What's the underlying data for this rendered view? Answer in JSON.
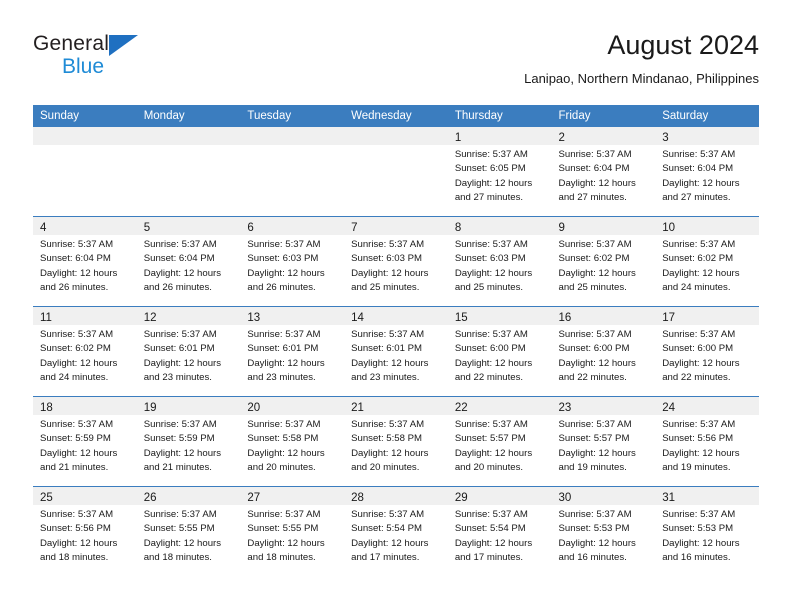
{
  "brand": {
    "name_top": "General",
    "name_bottom": "Blue",
    "accent_blue": "#1f8bd6",
    "triangle_blue": "#1f70c1"
  },
  "header": {
    "title": "August 2024",
    "subtitle": "Lanipao, Northern Mindanao, Philippines"
  },
  "theme": {
    "header_row_bg": "#3b7dbf",
    "header_row_text": "#ffffff",
    "daynum_band_bg": "#f0f0f0",
    "week_separator": "#3b7dbf",
    "cell_bg": "#ffffff",
    "text": "#1a1a1a"
  },
  "weekdays": [
    "Sunday",
    "Monday",
    "Tuesday",
    "Wednesday",
    "Thursday",
    "Friday",
    "Saturday"
  ],
  "weeks": [
    [
      {
        "day": "",
        "empty": true
      },
      {
        "day": "",
        "empty": true
      },
      {
        "day": "",
        "empty": true
      },
      {
        "day": "",
        "empty": true
      },
      {
        "day": "1",
        "sunrise": "Sunrise: 5:37 AM",
        "sunset": "Sunset: 6:05 PM",
        "daylight_1": "Daylight: 12 hours",
        "daylight_2": "and 27 minutes."
      },
      {
        "day": "2",
        "sunrise": "Sunrise: 5:37 AM",
        "sunset": "Sunset: 6:04 PM",
        "daylight_1": "Daylight: 12 hours",
        "daylight_2": "and 27 minutes."
      },
      {
        "day": "3",
        "sunrise": "Sunrise: 5:37 AM",
        "sunset": "Sunset: 6:04 PM",
        "daylight_1": "Daylight: 12 hours",
        "daylight_2": "and 27 minutes."
      }
    ],
    [
      {
        "day": "4",
        "sunrise": "Sunrise: 5:37 AM",
        "sunset": "Sunset: 6:04 PM",
        "daylight_1": "Daylight: 12 hours",
        "daylight_2": "and 26 minutes."
      },
      {
        "day": "5",
        "sunrise": "Sunrise: 5:37 AM",
        "sunset": "Sunset: 6:04 PM",
        "daylight_1": "Daylight: 12 hours",
        "daylight_2": "and 26 minutes."
      },
      {
        "day": "6",
        "sunrise": "Sunrise: 5:37 AM",
        "sunset": "Sunset: 6:03 PM",
        "daylight_1": "Daylight: 12 hours",
        "daylight_2": "and 26 minutes."
      },
      {
        "day": "7",
        "sunrise": "Sunrise: 5:37 AM",
        "sunset": "Sunset: 6:03 PM",
        "daylight_1": "Daylight: 12 hours",
        "daylight_2": "and 25 minutes."
      },
      {
        "day": "8",
        "sunrise": "Sunrise: 5:37 AM",
        "sunset": "Sunset: 6:03 PM",
        "daylight_1": "Daylight: 12 hours",
        "daylight_2": "and 25 minutes."
      },
      {
        "day": "9",
        "sunrise": "Sunrise: 5:37 AM",
        "sunset": "Sunset: 6:02 PM",
        "daylight_1": "Daylight: 12 hours",
        "daylight_2": "and 25 minutes."
      },
      {
        "day": "10",
        "sunrise": "Sunrise: 5:37 AM",
        "sunset": "Sunset: 6:02 PM",
        "daylight_1": "Daylight: 12 hours",
        "daylight_2": "and 24 minutes."
      }
    ],
    [
      {
        "day": "11",
        "sunrise": "Sunrise: 5:37 AM",
        "sunset": "Sunset: 6:02 PM",
        "daylight_1": "Daylight: 12 hours",
        "daylight_2": "and 24 minutes."
      },
      {
        "day": "12",
        "sunrise": "Sunrise: 5:37 AM",
        "sunset": "Sunset: 6:01 PM",
        "daylight_1": "Daylight: 12 hours",
        "daylight_2": "and 23 minutes."
      },
      {
        "day": "13",
        "sunrise": "Sunrise: 5:37 AM",
        "sunset": "Sunset: 6:01 PM",
        "daylight_1": "Daylight: 12 hours",
        "daylight_2": "and 23 minutes."
      },
      {
        "day": "14",
        "sunrise": "Sunrise: 5:37 AM",
        "sunset": "Sunset: 6:01 PM",
        "daylight_1": "Daylight: 12 hours",
        "daylight_2": "and 23 minutes."
      },
      {
        "day": "15",
        "sunrise": "Sunrise: 5:37 AM",
        "sunset": "Sunset: 6:00 PM",
        "daylight_1": "Daylight: 12 hours",
        "daylight_2": "and 22 minutes."
      },
      {
        "day": "16",
        "sunrise": "Sunrise: 5:37 AM",
        "sunset": "Sunset: 6:00 PM",
        "daylight_1": "Daylight: 12 hours",
        "daylight_2": "and 22 minutes."
      },
      {
        "day": "17",
        "sunrise": "Sunrise: 5:37 AM",
        "sunset": "Sunset: 6:00 PM",
        "daylight_1": "Daylight: 12 hours",
        "daylight_2": "and 22 minutes."
      }
    ],
    [
      {
        "day": "18",
        "sunrise": "Sunrise: 5:37 AM",
        "sunset": "Sunset: 5:59 PM",
        "daylight_1": "Daylight: 12 hours",
        "daylight_2": "and 21 minutes."
      },
      {
        "day": "19",
        "sunrise": "Sunrise: 5:37 AM",
        "sunset": "Sunset: 5:59 PM",
        "daylight_1": "Daylight: 12 hours",
        "daylight_2": "and 21 minutes."
      },
      {
        "day": "20",
        "sunrise": "Sunrise: 5:37 AM",
        "sunset": "Sunset: 5:58 PM",
        "daylight_1": "Daylight: 12 hours",
        "daylight_2": "and 20 minutes."
      },
      {
        "day": "21",
        "sunrise": "Sunrise: 5:37 AM",
        "sunset": "Sunset: 5:58 PM",
        "daylight_1": "Daylight: 12 hours",
        "daylight_2": "and 20 minutes."
      },
      {
        "day": "22",
        "sunrise": "Sunrise: 5:37 AM",
        "sunset": "Sunset: 5:57 PM",
        "daylight_1": "Daylight: 12 hours",
        "daylight_2": "and 20 minutes."
      },
      {
        "day": "23",
        "sunrise": "Sunrise: 5:37 AM",
        "sunset": "Sunset: 5:57 PM",
        "daylight_1": "Daylight: 12 hours",
        "daylight_2": "and 19 minutes."
      },
      {
        "day": "24",
        "sunrise": "Sunrise: 5:37 AM",
        "sunset": "Sunset: 5:56 PM",
        "daylight_1": "Daylight: 12 hours",
        "daylight_2": "and 19 minutes."
      }
    ],
    [
      {
        "day": "25",
        "sunrise": "Sunrise: 5:37 AM",
        "sunset": "Sunset: 5:56 PM",
        "daylight_1": "Daylight: 12 hours",
        "daylight_2": "and 18 minutes."
      },
      {
        "day": "26",
        "sunrise": "Sunrise: 5:37 AM",
        "sunset": "Sunset: 5:55 PM",
        "daylight_1": "Daylight: 12 hours",
        "daylight_2": "and 18 minutes."
      },
      {
        "day": "27",
        "sunrise": "Sunrise: 5:37 AM",
        "sunset": "Sunset: 5:55 PM",
        "daylight_1": "Daylight: 12 hours",
        "daylight_2": "and 18 minutes."
      },
      {
        "day": "28",
        "sunrise": "Sunrise: 5:37 AM",
        "sunset": "Sunset: 5:54 PM",
        "daylight_1": "Daylight: 12 hours",
        "daylight_2": "and 17 minutes."
      },
      {
        "day": "29",
        "sunrise": "Sunrise: 5:37 AM",
        "sunset": "Sunset: 5:54 PM",
        "daylight_1": "Daylight: 12 hours",
        "daylight_2": "and 17 minutes."
      },
      {
        "day": "30",
        "sunrise": "Sunrise: 5:37 AM",
        "sunset": "Sunset: 5:53 PM",
        "daylight_1": "Daylight: 12 hours",
        "daylight_2": "and 16 minutes."
      },
      {
        "day": "31",
        "sunrise": "Sunrise: 5:37 AM",
        "sunset": "Sunset: 5:53 PM",
        "daylight_1": "Daylight: 12 hours",
        "daylight_2": "and 16 minutes."
      }
    ]
  ]
}
